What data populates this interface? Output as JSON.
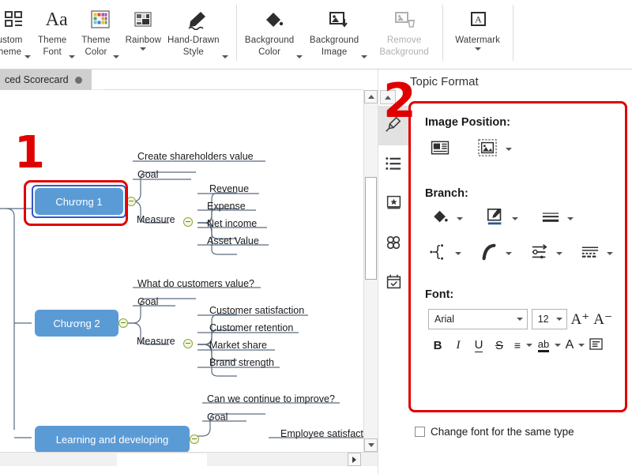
{
  "ribbon": {
    "items": [
      {
        "label": "ustom\nheme",
        "icon": "custom-theme-icon",
        "caret": true,
        "disabled": false
      },
      {
        "label": "Theme\nFont",
        "icon": "theme-font-icon",
        "caret": true,
        "disabled": false
      },
      {
        "label": "Theme\nColor",
        "icon": "theme-color-icon",
        "caret": true,
        "disabled": false
      },
      {
        "label": "Rainbow",
        "icon": "rainbow-icon",
        "caret": true,
        "disabled": false
      },
      {
        "label": "Hand-Drawn\nStyle",
        "icon": "hand-drawn-icon",
        "caret": true,
        "disabled": false
      },
      {
        "label": "Background\nColor",
        "icon": "background-color-icon",
        "caret": true,
        "disabled": false
      },
      {
        "label": "Background\nImage",
        "icon": "background-image-icon",
        "caret": true,
        "disabled": false
      },
      {
        "label": "Remove\nBackground",
        "icon": "remove-background-icon",
        "caret": false,
        "disabled": true
      },
      {
        "label": "Watermark",
        "icon": "watermark-icon",
        "caret": true,
        "disabled": false
      }
    ]
  },
  "document_tab": {
    "label": "ced Scorecard",
    "modified_dot": "●"
  },
  "annotations": {
    "step_one": "1",
    "step_two": "2",
    "color": "#e00000"
  },
  "mindmap": {
    "nodes": [
      {
        "id": "chuong1",
        "label": "Chương 1",
        "selected": true
      },
      {
        "id": "chuong2",
        "label": "Chương 2",
        "selected": false
      },
      {
        "id": "learning",
        "label": "Learning and developing",
        "selected": false
      }
    ],
    "topics": [
      {
        "text": "Create shareholders value"
      },
      {
        "text": "Goal"
      },
      {
        "text": "Measure"
      },
      {
        "text": "Revenue"
      },
      {
        "text": "Expense"
      },
      {
        "text": "Net income"
      },
      {
        "text": "Asset Value"
      },
      {
        "text": "What do customers value?"
      },
      {
        "text": "Goal"
      },
      {
        "text": "Measure"
      },
      {
        "text": "Customer satisfaction"
      },
      {
        "text": "Customer retention"
      },
      {
        "text": "Market share"
      },
      {
        "text": "Brand strength"
      },
      {
        "text": "Can we continue to improve?"
      },
      {
        "text": "Goal"
      },
      {
        "text": "Employee satisfact"
      }
    ],
    "node_color": "#5b9bd5",
    "selection_color": "#3355cc"
  },
  "panel": {
    "title": "Topic Format",
    "vtabs": [
      {
        "name": "style-tab",
        "icon": "paint-brush-icon",
        "active": true
      },
      {
        "name": "outline-tab",
        "icon": "bullet-list-icon",
        "active": false
      },
      {
        "name": "sticker-tab",
        "icon": "sticker-badge-icon",
        "active": false
      },
      {
        "name": "clipart-tab",
        "icon": "clover-icon",
        "active": false
      },
      {
        "name": "task-tab",
        "icon": "calendar-check-icon",
        "active": false
      }
    ],
    "image_position": {
      "label": "Image Position:",
      "buttons": [
        {
          "name": "image-inline-button",
          "icon": "image-left-text-icon",
          "caret": false
        },
        {
          "name": "image-fill-button",
          "icon": "image-frame-icon",
          "caret": true
        }
      ]
    },
    "branch": {
      "label": "Branch:",
      "row1": [
        {
          "name": "branch-fill-color-button",
          "icon": "paint-bucket-icon",
          "caret": true
        },
        {
          "name": "branch-edit-style-button",
          "icon": "pencil-box-icon",
          "caret": true
        },
        {
          "name": "branch-line-width-button",
          "icon": "line-weight-icon",
          "caret": true
        }
      ],
      "row2": [
        {
          "name": "branch-structure-button",
          "icon": "node-structure-icon",
          "caret": true
        },
        {
          "name": "branch-curve-button",
          "icon": "curve-icon",
          "caret": true
        },
        {
          "name": "branch-arrow-style-button",
          "icon": "arrow-settings-icon",
          "caret": true
        },
        {
          "name": "branch-dash-style-button",
          "icon": "dash-pattern-icon",
          "caret": true
        }
      ]
    },
    "font": {
      "label": "Font:",
      "family_value": "Arial",
      "size_value": "12",
      "increase_label": "A⁺",
      "decrease_label": "A⁻",
      "format_buttons": [
        {
          "name": "bold-button",
          "glyph": "B",
          "caret": false
        },
        {
          "name": "italic-button",
          "glyph": "I",
          "caret": false
        },
        {
          "name": "underline-button",
          "glyph": "U",
          "caret": false
        },
        {
          "name": "strikethrough-button",
          "glyph": "S",
          "caret": false
        },
        {
          "name": "align-button",
          "glyph": "≡",
          "caret": true
        },
        {
          "name": "text-highlight-button",
          "glyph": "ab",
          "caret": true
        },
        {
          "name": "font-color-button",
          "glyph": "A",
          "caret": true
        },
        {
          "name": "text-direction-button",
          "glyph": "▤",
          "caret": false
        }
      ]
    },
    "same_type_checkbox": {
      "label": "Change font for the same type",
      "checked": false
    }
  }
}
